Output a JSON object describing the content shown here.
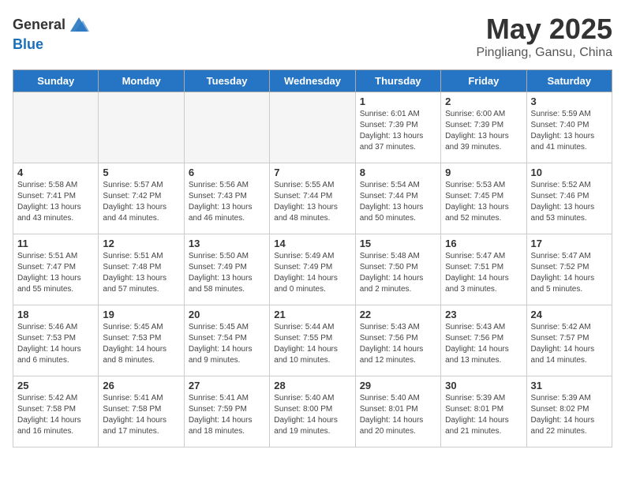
{
  "header": {
    "logo_general": "General",
    "logo_blue": "Blue",
    "title": "May 2025",
    "subtitle": "Pingliang, Gansu, China"
  },
  "days_of_week": [
    "Sunday",
    "Monday",
    "Tuesday",
    "Wednesday",
    "Thursday",
    "Friday",
    "Saturday"
  ],
  "weeks": [
    [
      {
        "num": "",
        "info": ""
      },
      {
        "num": "",
        "info": ""
      },
      {
        "num": "",
        "info": ""
      },
      {
        "num": "",
        "info": ""
      },
      {
        "num": "1",
        "info": "Sunrise: 6:01 AM\nSunset: 7:39 PM\nDaylight: 13 hours\nand 37 minutes."
      },
      {
        "num": "2",
        "info": "Sunrise: 6:00 AM\nSunset: 7:39 PM\nDaylight: 13 hours\nand 39 minutes."
      },
      {
        "num": "3",
        "info": "Sunrise: 5:59 AM\nSunset: 7:40 PM\nDaylight: 13 hours\nand 41 minutes."
      }
    ],
    [
      {
        "num": "4",
        "info": "Sunrise: 5:58 AM\nSunset: 7:41 PM\nDaylight: 13 hours\nand 43 minutes."
      },
      {
        "num": "5",
        "info": "Sunrise: 5:57 AM\nSunset: 7:42 PM\nDaylight: 13 hours\nand 44 minutes."
      },
      {
        "num": "6",
        "info": "Sunrise: 5:56 AM\nSunset: 7:43 PM\nDaylight: 13 hours\nand 46 minutes."
      },
      {
        "num": "7",
        "info": "Sunrise: 5:55 AM\nSunset: 7:44 PM\nDaylight: 13 hours\nand 48 minutes."
      },
      {
        "num": "8",
        "info": "Sunrise: 5:54 AM\nSunset: 7:44 PM\nDaylight: 13 hours\nand 50 minutes."
      },
      {
        "num": "9",
        "info": "Sunrise: 5:53 AM\nSunset: 7:45 PM\nDaylight: 13 hours\nand 52 minutes."
      },
      {
        "num": "10",
        "info": "Sunrise: 5:52 AM\nSunset: 7:46 PM\nDaylight: 13 hours\nand 53 minutes."
      }
    ],
    [
      {
        "num": "11",
        "info": "Sunrise: 5:51 AM\nSunset: 7:47 PM\nDaylight: 13 hours\nand 55 minutes."
      },
      {
        "num": "12",
        "info": "Sunrise: 5:51 AM\nSunset: 7:48 PM\nDaylight: 13 hours\nand 57 minutes."
      },
      {
        "num": "13",
        "info": "Sunrise: 5:50 AM\nSunset: 7:49 PM\nDaylight: 13 hours\nand 58 minutes."
      },
      {
        "num": "14",
        "info": "Sunrise: 5:49 AM\nSunset: 7:49 PM\nDaylight: 14 hours\nand 0 minutes."
      },
      {
        "num": "15",
        "info": "Sunrise: 5:48 AM\nSunset: 7:50 PM\nDaylight: 14 hours\nand 2 minutes."
      },
      {
        "num": "16",
        "info": "Sunrise: 5:47 AM\nSunset: 7:51 PM\nDaylight: 14 hours\nand 3 minutes."
      },
      {
        "num": "17",
        "info": "Sunrise: 5:47 AM\nSunset: 7:52 PM\nDaylight: 14 hours\nand 5 minutes."
      }
    ],
    [
      {
        "num": "18",
        "info": "Sunrise: 5:46 AM\nSunset: 7:53 PM\nDaylight: 14 hours\nand 6 minutes."
      },
      {
        "num": "19",
        "info": "Sunrise: 5:45 AM\nSunset: 7:53 PM\nDaylight: 14 hours\nand 8 minutes."
      },
      {
        "num": "20",
        "info": "Sunrise: 5:45 AM\nSunset: 7:54 PM\nDaylight: 14 hours\nand 9 minutes."
      },
      {
        "num": "21",
        "info": "Sunrise: 5:44 AM\nSunset: 7:55 PM\nDaylight: 14 hours\nand 10 minutes."
      },
      {
        "num": "22",
        "info": "Sunrise: 5:43 AM\nSunset: 7:56 PM\nDaylight: 14 hours\nand 12 minutes."
      },
      {
        "num": "23",
        "info": "Sunrise: 5:43 AM\nSunset: 7:56 PM\nDaylight: 14 hours\nand 13 minutes."
      },
      {
        "num": "24",
        "info": "Sunrise: 5:42 AM\nSunset: 7:57 PM\nDaylight: 14 hours\nand 14 minutes."
      }
    ],
    [
      {
        "num": "25",
        "info": "Sunrise: 5:42 AM\nSunset: 7:58 PM\nDaylight: 14 hours\nand 16 minutes."
      },
      {
        "num": "26",
        "info": "Sunrise: 5:41 AM\nSunset: 7:58 PM\nDaylight: 14 hours\nand 17 minutes."
      },
      {
        "num": "27",
        "info": "Sunrise: 5:41 AM\nSunset: 7:59 PM\nDaylight: 14 hours\nand 18 minutes."
      },
      {
        "num": "28",
        "info": "Sunrise: 5:40 AM\nSunset: 8:00 PM\nDaylight: 14 hours\nand 19 minutes."
      },
      {
        "num": "29",
        "info": "Sunrise: 5:40 AM\nSunset: 8:01 PM\nDaylight: 14 hours\nand 20 minutes."
      },
      {
        "num": "30",
        "info": "Sunrise: 5:39 AM\nSunset: 8:01 PM\nDaylight: 14 hours\nand 21 minutes."
      },
      {
        "num": "31",
        "info": "Sunrise: 5:39 AM\nSunset: 8:02 PM\nDaylight: 14 hours\nand 22 minutes."
      }
    ]
  ]
}
